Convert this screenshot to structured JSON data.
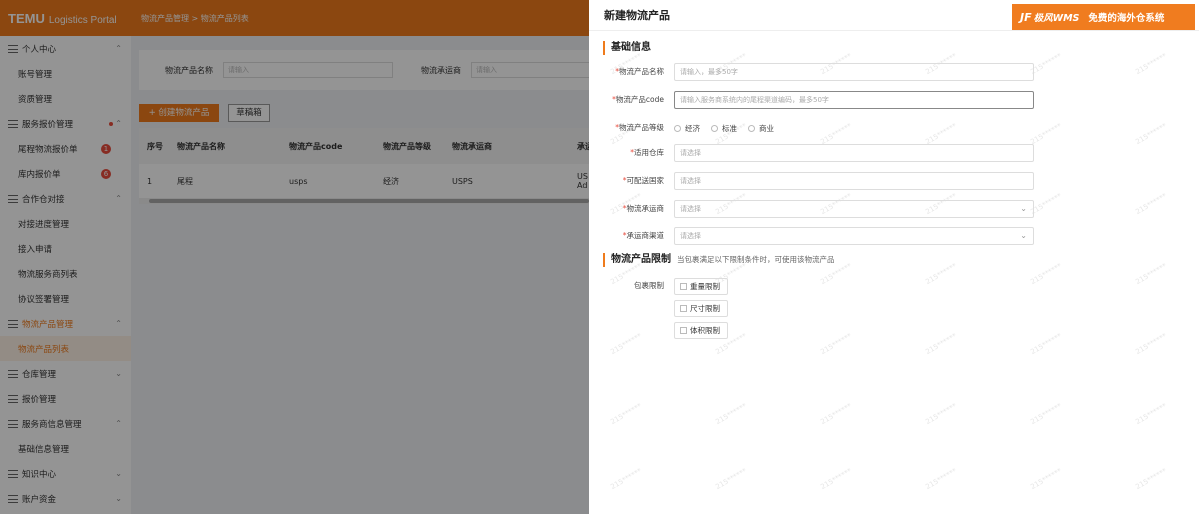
{
  "app": {
    "logo_brand": "TEMU",
    "logo_sub": "Logistics Portal",
    "breadcrumb": "物流产品管理 > 物流产品列表"
  },
  "sidebar": {
    "items": [
      {
        "label": "个人中心",
        "type": "group",
        "chevron": "^"
      },
      {
        "label": "账号管理",
        "type": "child"
      },
      {
        "label": "资质管理",
        "type": "child"
      },
      {
        "label": "服务报价管理",
        "type": "group",
        "chevron": "^",
        "dot": true
      },
      {
        "label": "尾程物流报价单",
        "type": "child",
        "badge": "1"
      },
      {
        "label": "库内报价单",
        "type": "child",
        "badge": "6"
      },
      {
        "label": "合作仓对接",
        "type": "group",
        "chevron": "^"
      },
      {
        "label": "对接进度管理",
        "type": "child"
      },
      {
        "label": "接入申请",
        "type": "child"
      },
      {
        "label": "物流服务商列表",
        "type": "child"
      },
      {
        "label": "协议签署管理",
        "type": "child"
      },
      {
        "label": "物流产品管理",
        "type": "group",
        "chevron": "^",
        "active": true
      },
      {
        "label": "物流产品列表",
        "type": "child",
        "active": true
      },
      {
        "label": "仓库管理",
        "type": "group",
        "chevron": "v"
      },
      {
        "label": "报价管理",
        "type": "group"
      },
      {
        "label": "服务商信息管理",
        "type": "group",
        "chevron": "^"
      },
      {
        "label": "基础信息管理",
        "type": "child"
      },
      {
        "label": "知识中心",
        "type": "group",
        "chevron": "v"
      },
      {
        "label": "账户资金",
        "type": "group",
        "chevron": "v"
      }
    ]
  },
  "filter": {
    "name_label": "物流产品名称",
    "name_placeholder": "请输入",
    "carrier_label": "物流承运商",
    "carrier_placeholder": "请输入"
  },
  "toolbar": {
    "create_label": "+ 创建物流产品",
    "draft_label": "草稿箱"
  },
  "table": {
    "headers": [
      "序号",
      "物流产品名称",
      "物流产品code",
      "物流产品等级",
      "物流承运商",
      "承运"
    ],
    "rows": [
      [
        "1",
        "尾程",
        "usps",
        "经济",
        "USPS",
        "US Ad"
      ]
    ]
  },
  "drawer": {
    "title": "新建物流产品",
    "ad": {
      "mark": "JF",
      "brand": "极风WMS",
      "text": "免费的海外仓系统"
    },
    "section_basic": "基础信息",
    "fields": {
      "name": {
        "label": "物流产品名称",
        "placeholder": "请输入，最多50字"
      },
      "code": {
        "label": "物流产品code",
        "placeholder": "请输入服务商系统内的尾程渠道编码，最多50字"
      },
      "level": {
        "label": "物流产品等级",
        "options": [
          "经济",
          "标准",
          "商业"
        ]
      },
      "warehouse": {
        "label": "适用仓库",
        "placeholder": "请选择"
      },
      "country": {
        "label": "可配送国家",
        "placeholder": "请选择"
      },
      "carrier": {
        "label": "物流承运商",
        "placeholder": "请选择"
      },
      "channel": {
        "label": "承运商渠道",
        "placeholder": "请选择"
      }
    },
    "section_limit": "物流产品限制",
    "section_limit_hint": "当包裹满足以下限制条件时，可使用该物流产品",
    "package_limit_label": "包裹限制",
    "checkboxes": [
      "重量限制",
      "尺寸限制",
      "体积限制"
    ],
    "required_mark": "*",
    "watermark": "215******"
  }
}
